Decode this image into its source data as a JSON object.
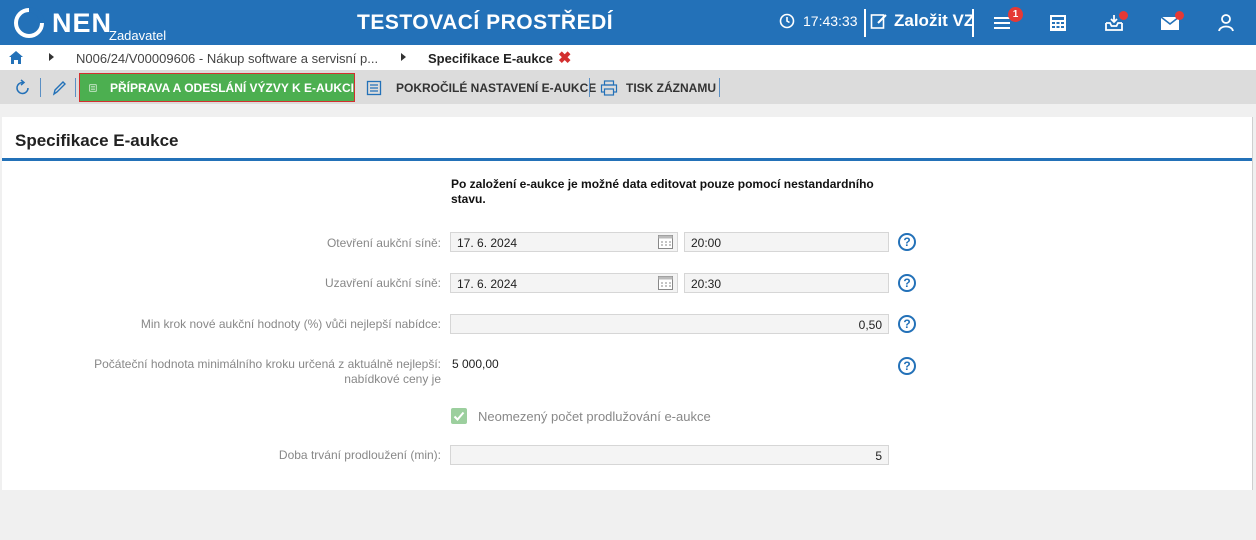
{
  "header": {
    "app_name": "NEN",
    "app_subtitle": "Zadavatel",
    "environment": "TESTOVACÍ PROSTŘEDÍ",
    "time": "17:43:33",
    "create_label": "Založit VZ",
    "menu_badge": "1",
    "brand_color": "#2371b8"
  },
  "breadcrumb": {
    "items": [
      {
        "label": "N006/24/V00009606 - Nákup software a servisní p..."
      },
      {
        "label": "Specifikace E-aukce"
      }
    ],
    "close_glyph": "✖"
  },
  "toolbar": {
    "primary_label": "PŘÍPRAVA A ODESLÁNÍ VÝZVY K E-AUKCI",
    "advanced_label": "POKROČILÉ NASTAVENÍ E-AUKCE",
    "print_label": "TISK ZÁZNAMU",
    "primary_color": "#4caf50"
  },
  "form": {
    "title": "Specifikace E-aukce",
    "notice": "Po založení e-aukce je možné data editovat pouze pomocí nestandardního stavu.",
    "open_label": "Otevření aukční síně:",
    "open_date": "17. 6. 2024",
    "open_time": "20:00",
    "close_label": "Uzavření aukční síně:",
    "close_date": "17. 6. 2024",
    "close_time": "20:30",
    "min_step_label": "Min krok nové aukční hodnoty (%) vůči nejlepší nabídce:",
    "min_step_value": "0,50",
    "initial_label_1": "Počáteční hodnota minimálního kroku určená z aktuálně nejlepší:",
    "initial_label_2": "nabídkové ceny je",
    "initial_value": "5 000,00",
    "unlimited_label": "Neomezený počet prodlužování e-aukce",
    "unlimited_checked": true,
    "duration_label": "Doba trvání prodloužení (min):",
    "duration_value": "5",
    "help_glyph": "?"
  }
}
